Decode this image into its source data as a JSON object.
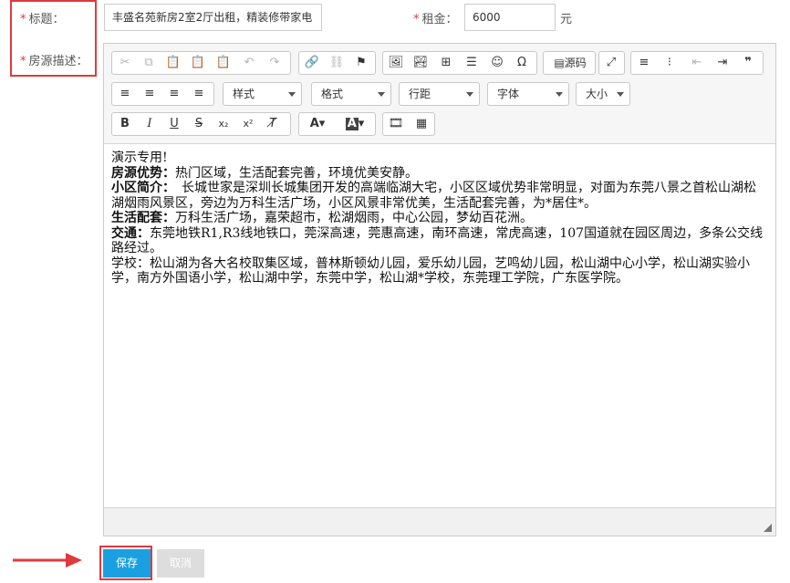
{
  "form": {
    "title_label": "标题：",
    "desc_label": "房源描述：",
    "rent_label": "租金：",
    "required_mark": "*",
    "title_value": "丰盛名苑新房2室2厅出租，精装修带家电",
    "rent_value": "6000",
    "rent_unit": "元"
  },
  "toolbar": {
    "source_label": "源码",
    "style_select": "样式",
    "format_select": "格式",
    "lineheight_select": "行距",
    "font_select": "字体",
    "size_select": "大小"
  },
  "content": {
    "line1": "演示专用!",
    "line2_bold": "房源优势：",
    "line2_text": "热门区域，生活配套完善，环境优美安静。",
    "line3_bold": "小区简介：",
    "line3_text": "　长城世家是深圳长城集团开发的高端临湖大宅，小区区域优势非常明显，对面为东莞八景之首松山湖松湖烟雨风景区，旁边为万科生活广场，小区风景非常优美，生活配套完善，为*居住*。",
    "line4_bold": "生活配套：",
    "line4_text": "万科生活广场，嘉荣超市，松湖烟雨，中心公园，梦幼百花洲。",
    "line5_bold": "交通：",
    "line5_text": "东莞地铁R1,R3线地铁口，莞深高速，莞惠高速，南环高速，常虎高速，107国道就在园区周边，多条公交线路经过。",
    "line6_text": "学校：松山湖为各大名校取集区域，普林斯顿幼儿园，爱乐幼儿园，艺鸣幼儿园，松山湖中心小学，松山湖实验小学，南方外国语小学，松山湖中学，东莞中学，松山湖*学校，东莞理工学院，广东医学院。"
  },
  "actions": {
    "save_label": "保存",
    "cancel_label": "取消"
  },
  "colors": {
    "accent_red": "#e0393e",
    "primary_blue": "#1aa0e0",
    "disabled_gray": "#dddddd"
  }
}
